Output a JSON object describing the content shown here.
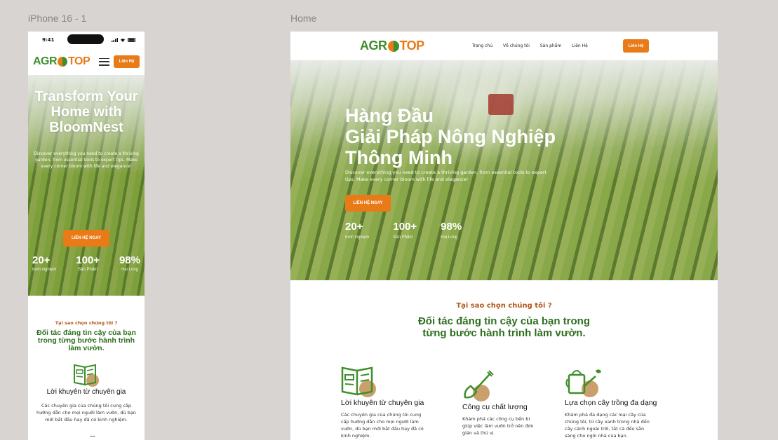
{
  "frames": {
    "mobile_label": "iPhone 16 - 1",
    "desktop_label": "Home"
  },
  "brand": {
    "logo_left": "AGR",
    "logo_right": "TOP",
    "colors": {
      "green": "#3f8f2c",
      "orange": "#e87b17",
      "dark_green": "#2e6f1f",
      "brown": "#b3571a"
    }
  },
  "mobile": {
    "status_time": "9:41",
    "contact_button": "Liên Hệ",
    "hero_title": "Transform Your Home with BloomNest",
    "hero_subtitle": "Discover everything you need to create a thriving garden, from essential tools to expert tips. Make every corner bloom with life and elegance!",
    "hero_cta": "LIÊN HỆ NGAY",
    "stats": [
      {
        "value": "20+",
        "label": "Kinh Nghiệm"
      },
      {
        "value": "100+",
        "label": "Sản Phẩm"
      },
      {
        "value": "98%",
        "label": "Hài Lòng"
      }
    ],
    "why_eyebrow": "Tại sao chọn chúng tôi ?",
    "why_heading": "Đối tác đáng tin cậy của bạn trong từng bước hành trình làm vườn.",
    "feature": {
      "icon": "book-icon",
      "title": "Lời khuyên từ chuyên gia",
      "desc": "Các chuyên gia của chúng tôi cung cấp hướng dẫn cho mọi người làm vườn, dù bạn mới bắt đầu hay đã có kinh nghiệm."
    }
  },
  "desktop": {
    "nav_links": [
      "Trang chủ",
      "Về chúng tôi",
      "Sản phẩm",
      "Liên Hệ"
    ],
    "contact_button": "Liên Hệ",
    "hero_title_line1": "Hàng Đầu",
    "hero_title_line2": "Giải Pháp Nông Nghiệp",
    "hero_title_line3": "Thông Minh",
    "hero_subtitle": "Discover everything you need to create a thriving garden, from essential tools to expert tips. Make every corner bloom with life and elegance!",
    "hero_cta": "LIÊN HỆ NGAY",
    "stats": [
      {
        "value": "20+",
        "label": "Kinh Nghiệm"
      },
      {
        "value": "100+",
        "label": "Sản Phẩm"
      },
      {
        "value": "98%",
        "label": "Hài Lòng"
      }
    ],
    "why_eyebrow": "Tại sao chọn chúng tôi ?",
    "why_heading_line1": "Đối tác đáng tin cậy của bạn trong",
    "why_heading_line2": "từng bước hành trình làm vườn.",
    "features": [
      {
        "icon": "book-icon",
        "title": "Lời khuyên từ chuyên gia",
        "desc": "Các chuyên gia của chúng tôi cung cấp hướng dẫn cho mọi người làm vườn, dù bạn mới bắt đầu hay đã có kinh nghiệm."
      },
      {
        "icon": "shovel-icon",
        "title": "Công cụ chất lượng",
        "desc": "Khám phá các công cụ bền bỉ giúp việc làm vườn trở nên đơn giản và thú vị."
      },
      {
        "icon": "watering-can-icon",
        "title": "Lựa chọn cây trồng đa dạng",
        "desc": "Khám phá đa dạng các loại cây của chúng tôi, từ cây xanh trong nhà đến cây cảnh ngoài trời, tất cả đều sẵn sàng cho ngôi nhà của bạn."
      }
    ]
  }
}
